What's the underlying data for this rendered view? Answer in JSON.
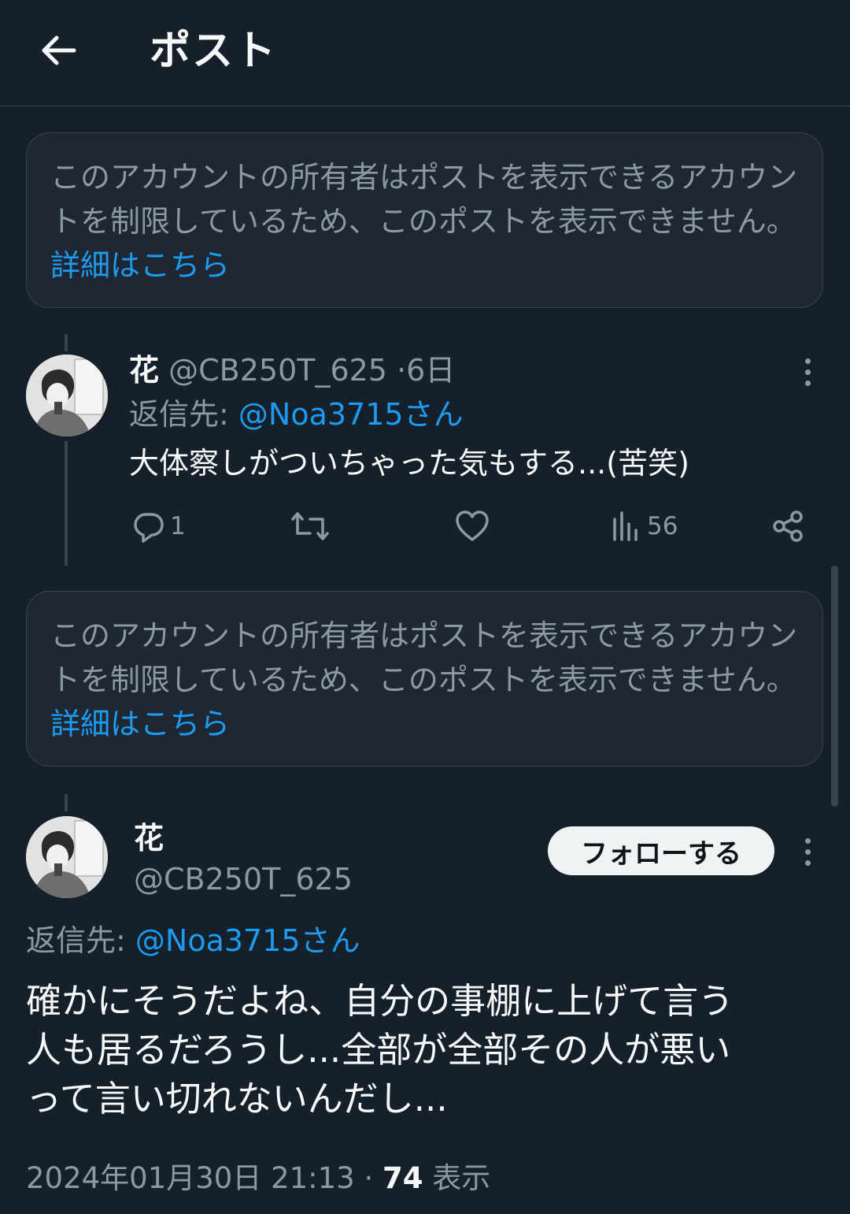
{
  "header": {
    "title": "ポスト"
  },
  "notice": {
    "text": "このアカウントの所有者はポストを表示できるアカウントを制限しているため、このポストを表示できません。",
    "link_text": "詳細はこちら"
  },
  "reply_post": {
    "display_name": "花",
    "handle": "@CB250T_625",
    "separator": "·",
    "time": "6日",
    "reply_prefix": "返信先:",
    "reply_to": "@Noa3715さん",
    "text": "大体察しがついちゃった気もする...(苦笑)",
    "reply_count": "1",
    "view_count": "56"
  },
  "main_post": {
    "display_name": "花",
    "handle": "@CB250T_625",
    "follow_label": "フォローする",
    "reply_prefix": "返信先:",
    "reply_to": "@Noa3715さん",
    "text_lines": [
      "確かにそうだよね、自分の事棚に上げて言う",
      "人も居るだろうし...全部が全部その人が悪い",
      "って言い切れないんだし..."
    ],
    "datetime": "2024年01月30日 21:13",
    "separator": "·",
    "views": "74",
    "views_label": "表示"
  },
  "colors": {
    "background": "#15202b",
    "accent": "#1d9bf0",
    "muted": "#8b98a5",
    "border": "#38444d"
  }
}
